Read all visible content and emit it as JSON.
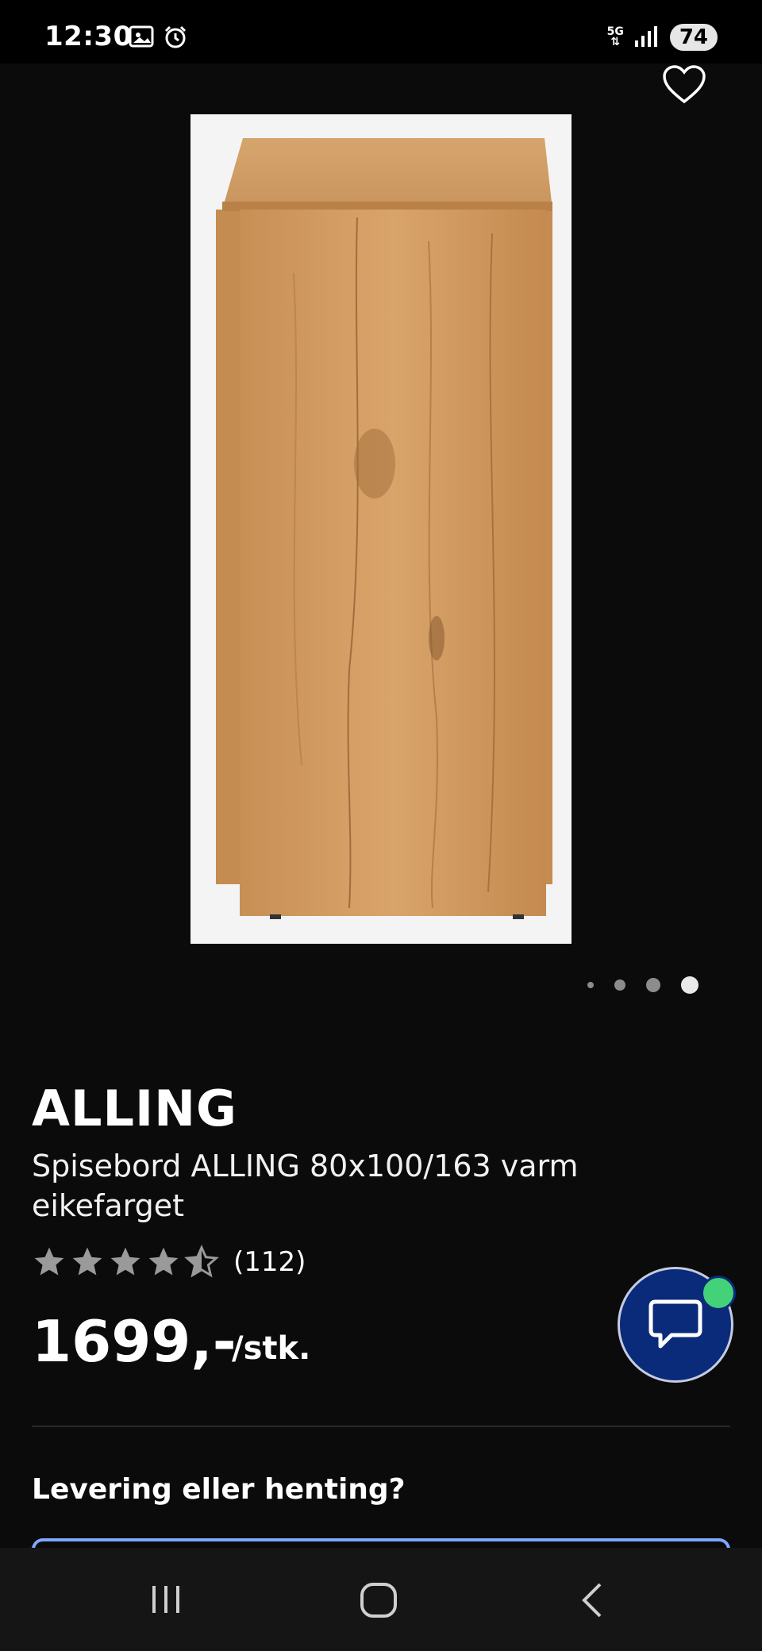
{
  "status_bar": {
    "time": "12:30",
    "network": "5G",
    "battery": "74"
  },
  "product": {
    "brand": "ALLING",
    "subtitle": "Spisebord ALLING 80x100/163 varm eikefarget",
    "rating_value": 4.5,
    "rating_max": 5,
    "review_count": "(112)",
    "price": "1699,-",
    "unit": "/stk."
  },
  "gallery": {
    "image_count": 4,
    "active_index": 3
  },
  "delivery": {
    "heading": "Levering eller henting?"
  },
  "colors": {
    "accent": "#0a2a7a",
    "online": "#43d17a",
    "option_border": "#7ea7ff",
    "star": "#9a9a9a"
  },
  "icons": {
    "favorite": "heart-icon",
    "chat": "chat-bubble-icon",
    "nav_recent": "recent-apps-icon",
    "nav_home": "home-icon",
    "nav_back": "back-icon"
  }
}
